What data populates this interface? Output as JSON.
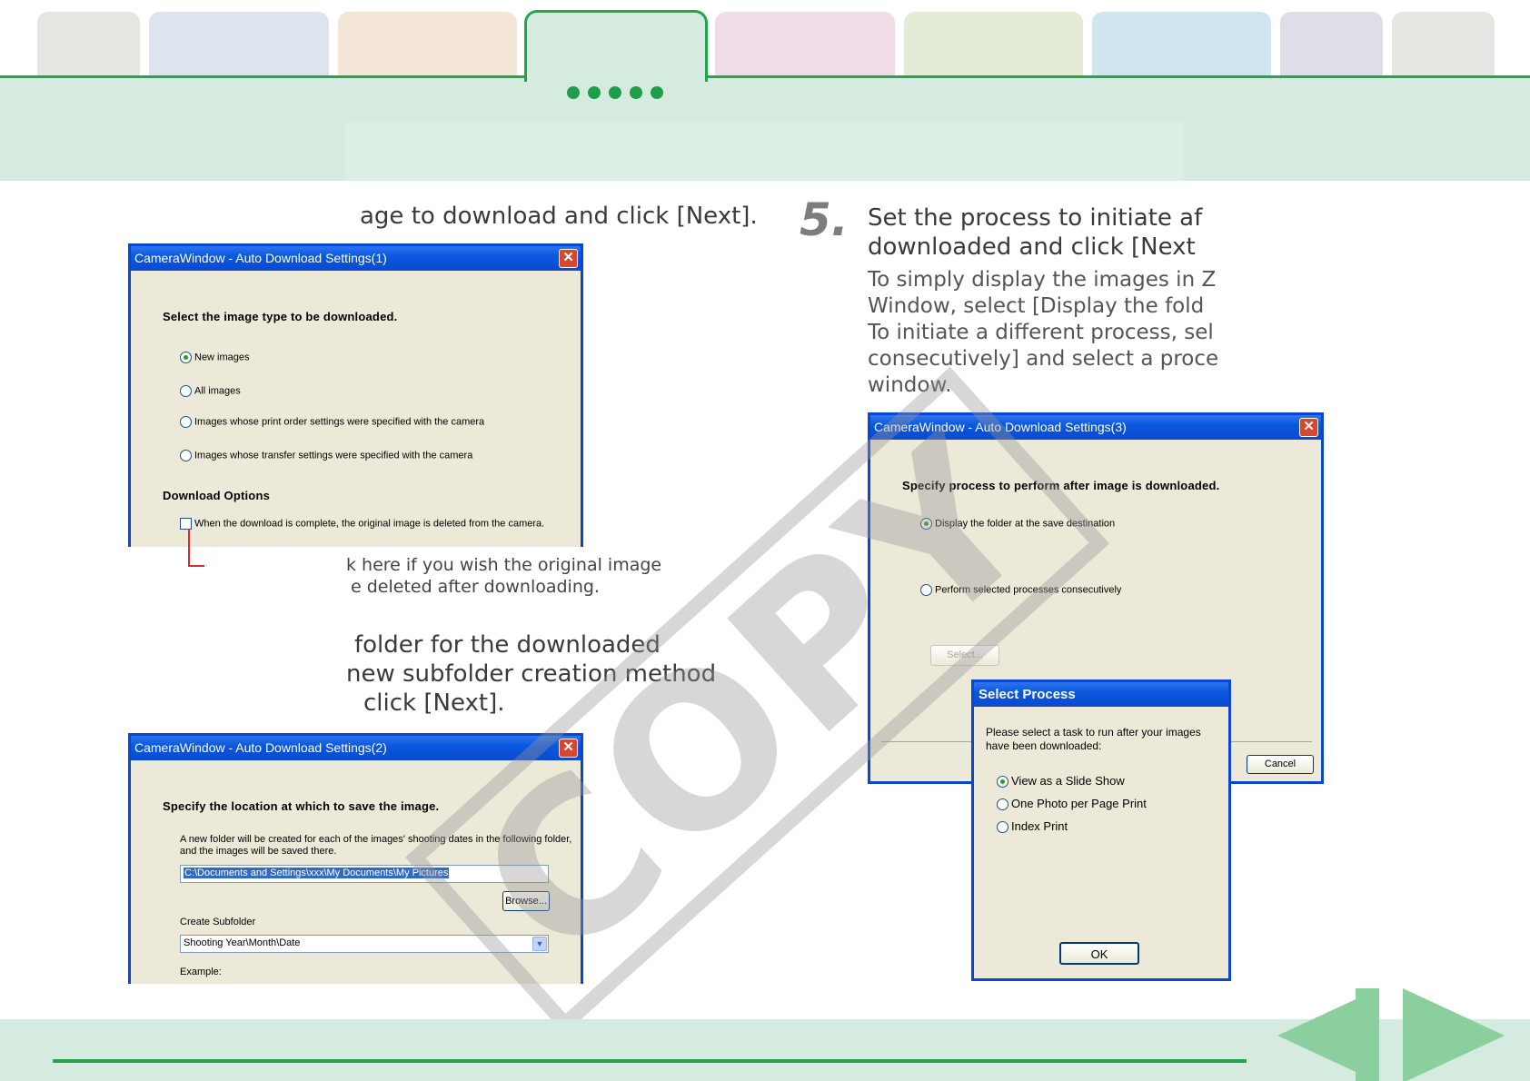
{
  "left": {
    "step3_text": "age to download and click [Next].",
    "dialog1": {
      "title": "CameraWindow - Auto Download Settings(1)",
      "heading": "Select the image type to be downloaded.",
      "options": [
        "New images",
        "All images",
        "Images whose print order settings were specified with the camera",
        "Images whose transfer settings were specified with the camera"
      ],
      "download_options_label": "Download Options",
      "delete_checkbox_label": "When the download is complete, the original image is deleted from the camera."
    },
    "annotation_line1": "k here if you wish the original image",
    "annotation_line2": "e deleted after downloading.",
    "step4_line1": "folder for the downloaded",
    "step4_line2": "new subfolder creation method",
    "step4_line3": "click [Next].",
    "dialog2": {
      "title": "CameraWindow - Auto Download Settings(2)",
      "heading": "Specify the location at which to save the image.",
      "desc_line1": "A new folder will be created for each of the images' shooting dates in the following folder,",
      "desc_line2": "and the images will be saved there.",
      "path_value": "C:\\Documents and Settings\\xxx\\My Documents\\My Pictures",
      "browse_label": "Browse...",
      "create_subfolder_label": "Create Subfolder",
      "subfolder_value": "Shooting Year\\Month\\Date",
      "example_label": "Example:"
    }
  },
  "right": {
    "step_number": "5.",
    "step_title_line1": "Set the process to initiate af",
    "step_title_line2": "downloaded and click [Next",
    "desc_lines": [
      "To simply display the images in Z",
      "Window, select [Display the fold",
      "To initiate a different process, sel",
      "consecutively] and select a proce",
      "window."
    ],
    "dialog3": {
      "title": "CameraWindow - Auto Download Settings(3)",
      "heading": "Specify process to perform after image is downloaded.",
      "option1": "Display the folder at the save destination",
      "option2": "Perform selected processes consecutively",
      "select_button": "Select...",
      "cancel_button": "Cancel"
    },
    "select_process": {
      "title": "Select Process",
      "desc_line1": "Please select a task to run after your images",
      "desc_line2": "have been downloaded:",
      "options": [
        "View as a Slide Show",
        "One Photo per Page Print",
        "Index Print"
      ],
      "ok_button": "OK"
    }
  },
  "watermark": "COPY",
  "colors": {
    "accent_green": "#22a64b",
    "header_band": "#d6ebdf",
    "xp_titlebar": "#0a58e0",
    "nav_arrow": "#8ccf9e"
  },
  "icons": [
    "close-icon",
    "prev-page-icon",
    "next-page-icon",
    "dropdown-chevron-icon"
  ]
}
